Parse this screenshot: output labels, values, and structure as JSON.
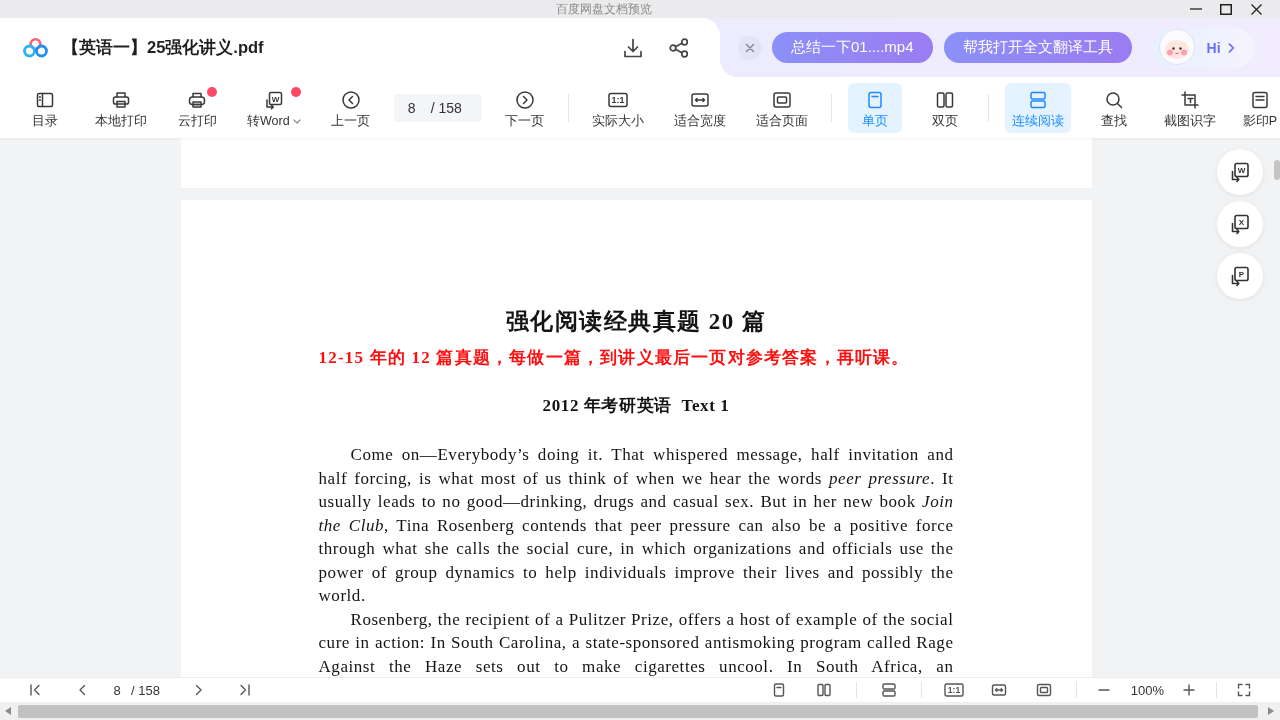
{
  "window": {
    "title": "百度网盘文档预览"
  },
  "header": {
    "file_name": "【英语一】25强化讲义.pdf",
    "suggestions": [
      {
        "label": "总结一下01....mp4"
      },
      {
        "label": "帮我打开全文翻译工具"
      }
    ],
    "assistant": {
      "greeting": "Hi"
    }
  },
  "toolbar": {
    "groups": [
      {
        "items": [
          {
            "kind": "contents",
            "label": "目录",
            "selected": false,
            "badge": false,
            "dropdown": false
          },
          {
            "kind": "print",
            "label": "本地打印",
            "selected": false,
            "badge": false,
            "dropdown": false
          },
          {
            "kind": "cloud_print",
            "label": "云打印",
            "selected": false,
            "badge": true,
            "dropdown": false
          },
          {
            "kind": "convert",
            "label": "转Word",
            "glyph": "W",
            "selected": false,
            "badge": true,
            "dropdown": true
          },
          {
            "kind": "previous",
            "label": "上一页",
            "selected": false,
            "badge": false,
            "dropdown": false
          },
          {
            "kind": "page",
            "value": "8",
            "total": "/ 158"
          },
          {
            "kind": "next",
            "label": "下一页",
            "selected": false,
            "badge": false,
            "dropdown": false
          }
        ]
      },
      {
        "items": [
          {
            "kind": "actual_size",
            "label": "实际大小",
            "glyph": "1:1",
            "selected": false,
            "badge": false,
            "dropdown": false
          },
          {
            "kind": "fit_width",
            "label": "适合宽度",
            "selected": false,
            "badge": false,
            "dropdown": false
          },
          {
            "kind": "fit_page",
            "label": "适合页面",
            "selected": false,
            "badge": false,
            "dropdown": false
          }
        ]
      },
      {
        "items": [
          {
            "kind": "single",
            "label": "单页",
            "selected": true,
            "badge": false,
            "dropdown": false
          },
          {
            "kind": "double",
            "label": "双页",
            "selected": false,
            "badge": false,
            "dropdown": false
          }
        ]
      },
      {
        "items": [
          {
            "kind": "continuous",
            "label": "连续阅读",
            "selected": true,
            "badge": false,
            "dropdown": false
          },
          {
            "kind": "find",
            "label": "查找",
            "selected": false,
            "badge": false,
            "dropdown": false
          },
          {
            "kind": "ocr",
            "label": "截图识字",
            "selected": false,
            "badge": false,
            "dropdown": false
          },
          {
            "kind": "photocopy",
            "label": "影印P",
            "selected": false,
            "badge": false,
            "dropdown": false
          }
        ]
      }
    ]
  },
  "document": {
    "blocks": [
      {
        "kind": "title",
        "text": "强化阅读经典真题 20 篇"
      },
      {
        "kind": "note",
        "text": "12-15 年的 12 篇真题，每做一篇，到讲义最后一页对参考答案，再听课。"
      },
      {
        "kind": "heading",
        "text": "2012 年考研英语  Text 1"
      },
      {
        "kind": "paragraph",
        "text": "Come on—Everybody’s doing it. That whispered message, half invitation and half forcing, is what most of us think of when we hear the words *peer pressure*. It usually leads to no good—drinking, drugs and casual sex. But in her new book *Join the Club*, Tina Rosenberg contends that peer pressure can also be a positive force through what she calls the social cure, in which organizations and officials use the power of group dynamics to help individuals improve their lives and possibly the world."
      },
      {
        "kind": "paragraph",
        "continues": true,
        "text": "Rosenberg, the recipient of a Pulitzer Prize, offers a host of example of the social cure in action: In South Carolina, a state-sponsored antismoking program called Rage Against the Haze sets out to make cigarettes uncool. In South Africa, an"
      }
    ]
  },
  "side_tools": [
    {
      "glyph": "W"
    },
    {
      "glyph": "X"
    },
    {
      "glyph": "P"
    }
  ],
  "bottom_bar": {
    "page": {
      "value": "8",
      "total": "/ 158"
    },
    "view_groups": [
      [
        {
          "kind": "single"
        },
        {
          "kind": "double"
        }
      ],
      [
        {
          "kind": "continuous"
        }
      ],
      [
        {
          "kind": "actual_size",
          "glyph": "1:1"
        },
        {
          "kind": "fit_width"
        },
        {
          "kind": "fit_page"
        }
      ]
    ],
    "zoom": "100%"
  }
}
